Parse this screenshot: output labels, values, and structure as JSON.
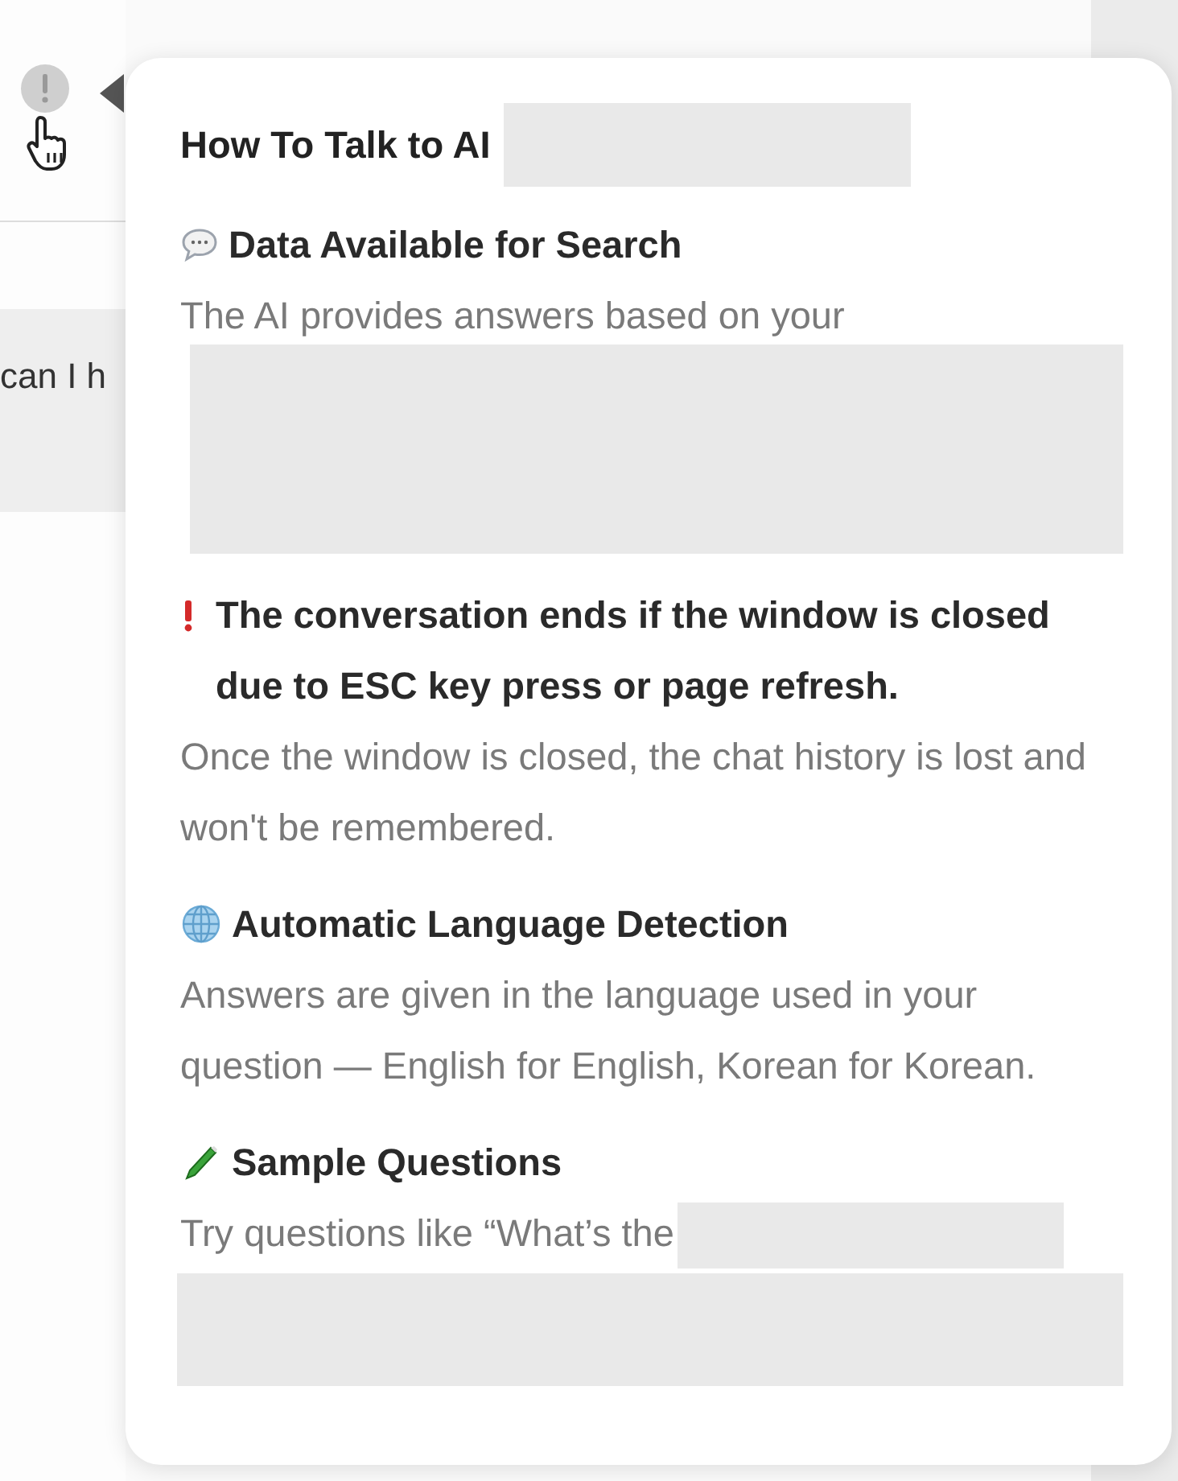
{
  "chat": {
    "message_fragment": "can I h"
  },
  "popover": {
    "title": "How To Talk to AI",
    "sections": [
      {
        "kind": "speech",
        "heading": "Data Available for Search",
        "body": "The AI provides answers based on your"
      },
      {
        "kind": "warning",
        "heading": "The conversation ends if the window is closed due to ESC key press or page refresh.",
        "body": "Once the window is closed, the chat history is lost and won't be remembered."
      },
      {
        "kind": "globe",
        "heading": "Automatic Language Detection",
        "body": "Answers are given in the language used in your question — English for English, Korean for Korean."
      },
      {
        "kind": "pen",
        "heading": "Sample Questions",
        "body": "Try questions like “What’s the"
      }
    ]
  }
}
